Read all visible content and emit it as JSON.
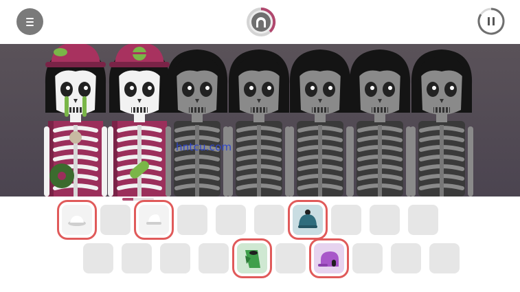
{
  "topbar": {
    "menu_icon": "hamburger-menu-icon",
    "center_icon": "arch-record-icon",
    "pause_icon": "pause-icon",
    "accent": "#b0486e"
  },
  "stage": {
    "watermark": "hntcu.com",
    "progress_fraction": 0.35,
    "characters": [
      {
        "state": "active",
        "costume": "magenta-cap-vinyl"
      },
      {
        "state": "active",
        "costume": "magenta-cap-pill"
      },
      {
        "state": "idle"
      },
      {
        "state": "idle"
      },
      {
        "state": "idle"
      },
      {
        "state": "idle"
      },
      {
        "state": "idle"
      }
    ]
  },
  "palette": {
    "row1": [
      {
        "icon": "white-hat-icon",
        "state": "used",
        "highlighted": true
      },
      {
        "icon": "empty-slot",
        "state": "empty",
        "highlighted": false
      },
      {
        "icon": "white-cap-icon",
        "state": "used",
        "highlighted": true
      },
      {
        "icon": "empty-slot",
        "state": "empty",
        "highlighted": false
      },
      {
        "icon": "empty-slot",
        "state": "empty",
        "highlighted": false
      },
      {
        "icon": "empty-slot",
        "state": "empty",
        "highlighted": false
      },
      {
        "icon": "teal-beanie-icon",
        "state": "available",
        "highlighted": true
      },
      {
        "icon": "empty-slot",
        "state": "empty",
        "highlighted": false
      },
      {
        "icon": "empty-slot",
        "state": "empty",
        "highlighted": false
      },
      {
        "icon": "empty-slot",
        "state": "empty",
        "highlighted": false
      }
    ],
    "row2": [
      {
        "icon": "empty-slot",
        "state": "empty",
        "highlighted": false
      },
      {
        "icon": "empty-slot",
        "state": "empty",
        "highlighted": false
      },
      {
        "icon": "empty-slot",
        "state": "empty",
        "highlighted": false
      },
      {
        "icon": "empty-slot",
        "state": "empty",
        "highlighted": false
      },
      {
        "icon": "green-hood-icon",
        "state": "available",
        "highlighted": true
      },
      {
        "icon": "empty-slot",
        "state": "empty",
        "highlighted": false
      },
      {
        "icon": "purple-cap-icon",
        "state": "available",
        "highlighted": true
      },
      {
        "icon": "empty-slot",
        "state": "empty",
        "highlighted": false
      },
      {
        "icon": "empty-slot",
        "state": "empty",
        "highlighted": false
      },
      {
        "icon": "empty-slot",
        "state": "empty",
        "highlighted": false
      }
    ],
    "colors": {
      "teal": "#2f6d7d",
      "green": "#3f9f4b",
      "purple": "#a857c9",
      "highlight": "#e05a5a"
    }
  }
}
